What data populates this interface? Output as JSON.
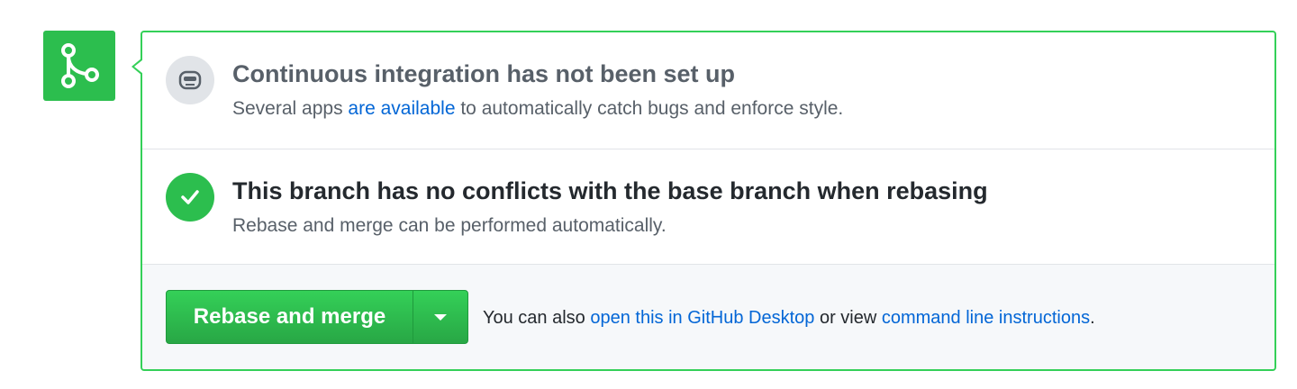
{
  "ci": {
    "title": "Continuous integration has not been set up",
    "desc_prefix": "Several apps ",
    "desc_link": "are available",
    "desc_suffix": " to automatically catch bugs and enforce style.",
    "icon": "robot-icon"
  },
  "conflicts": {
    "title": "This branch has no conflicts with the base branch when rebasing",
    "desc": "Rebase and merge can be performed automatically.",
    "icon": "check-icon"
  },
  "merge": {
    "button_label": "Rebase and merge",
    "dropdown_icon": "caret-down-icon",
    "also_prefix": "You can also ",
    "desktop_link": "open this in GitHub Desktop",
    "also_middle": " or view ",
    "cli_link": "command line instructions",
    "also_suffix": "."
  },
  "colors": {
    "success": "#2cbe4e",
    "border": "#34d058",
    "link": "#0366d6"
  }
}
